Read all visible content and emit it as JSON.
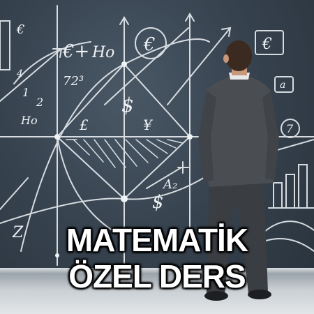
{
  "headline": {
    "line1": "MATEMATİK",
    "line2": "ÖZEL DERS"
  },
  "chalk_marks": {
    "euro_top_left": "€",
    "euro_mid": "€+",
    "ho_1": "Ho",
    "euro_circle": "€",
    "euro_box_right": "€",
    "num_72": "72³",
    "num_2": "2",
    "num_1": "1",
    "dollar": "$",
    "dollar_2": "$",
    "pound": "£",
    "yen": "¥",
    "ho_2": "Ho",
    "num_a2": "A₂",
    "num_7": "7",
    "num_4": "4",
    "num_a": "a",
    "z": "Z"
  },
  "colors": {
    "chalk": "#eef2f5",
    "board": "#37434f",
    "headline": "#ffffff"
  }
}
